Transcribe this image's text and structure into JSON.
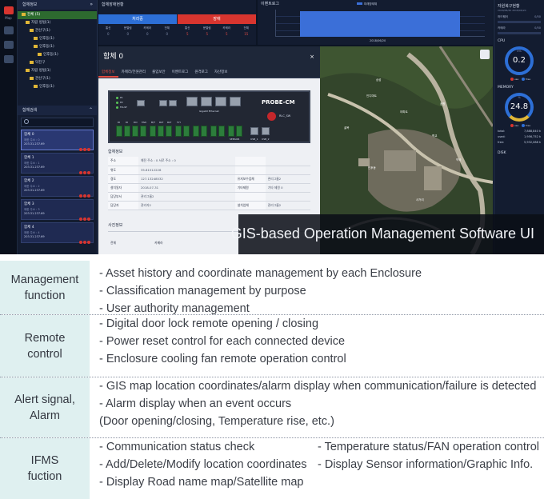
{
  "side_nav": {
    "items": [
      "Map",
      "",
      ""
    ]
  },
  "tree_panel": {
    "title": "함체정보",
    "nodes": [
      {
        "label": "전체 (5)",
        "depth": 1,
        "selected": true
      },
      {
        "label": "자람 방범(1)",
        "depth": 2
      },
      {
        "label": "관산구(1)",
        "depth": 3
      },
      {
        "label": "인후동(1)",
        "depth": 4
      },
      {
        "label": "인후동(1)",
        "depth": 4
      },
      {
        "label": "인후동(1)",
        "depth": 5
      },
      {
        "label": "덕진구",
        "depth": 3
      },
      {
        "label": "자람 방범(1)",
        "depth": 2
      },
      {
        "label": "관산구(1)",
        "depth": 3
      },
      {
        "label": "인후동(1)",
        "depth": 4
      }
    ]
  },
  "enclosure_search": {
    "title": "함체검색",
    "cards": [
      {
        "name": "함체 0",
        "sub": "제한 주소 : 0",
        "ip": "203.31.237.69",
        "selected": true
      },
      {
        "name": "함체 1",
        "sub": "제한 주소 : 1",
        "ip": "203.31.237.69"
      },
      {
        "name": "함체 2",
        "sub": "제한 주소 : 2",
        "ip": "203.31.237.69"
      },
      {
        "name": "함체 3",
        "sub": "제한 주소 : 3",
        "ip": "203.31.237.69"
      },
      {
        "name": "함체 4",
        "sub": "제한 주소 : 4",
        "ip": "203.31.237.69"
      }
    ]
  },
  "status": {
    "title": "함체장애현황",
    "normal": {
      "label": "처리중",
      "color": "#2d6fd6",
      "cols": [
        "통신",
        "문열림",
        "카메라",
        "전체"
      ],
      "vals": [
        "0",
        "0",
        "0",
        "0"
      ]
    },
    "fault": {
      "label": "장애",
      "color": "#d8352f",
      "cols": [
        "통신",
        "문열림",
        "카메라",
        "전체"
      ],
      "vals": [
        "5",
        "5",
        "5",
        "15"
      ]
    }
  },
  "event_log": {
    "title": "이벤트로그",
    "legend": "미래방재체",
    "date": "2018/06/20",
    "series_color": "#3b6fd8"
  },
  "resources": {
    "title": "자원복구현황",
    "subtitle": "2018/06/20 2018/06/20",
    "rows": [
      {
        "label": "하드웨어",
        "value": "0/50"
      },
      {
        "label": "카메라",
        "value": "0/50"
      }
    ],
    "cpu": {
      "title": "CPU",
      "value": "0.2",
      "pct_label": "0%",
      "legend_use": "use",
      "legend_free": "free"
    },
    "memory": {
      "title": "MEMORY",
      "value": "24.8",
      "pct_label": "%",
      "legend_use": "use",
      "legend_free": "free",
      "stats": [
        {
          "k": "total:",
          "v": "7,888,840 k"
        },
        {
          "k": "used:",
          "v": "1,956,752 k"
        },
        {
          "k": "free:",
          "v": "5,932,088 k"
        }
      ]
    },
    "disk": {
      "title": "DISK"
    }
  },
  "modal": {
    "title": "함체 0",
    "close": "×",
    "tabs": [
      "함체정보",
      "카메라/전원관리",
      "출입보안",
      "이벤트로그",
      "원격로그",
      "자산정보"
    ],
    "active_tab": 0,
    "device": {
      "brand": "PROBE-CM",
      "button_label": "RLC_SW",
      "leds": [
        "P1",
        "P2",
        "FAULT"
      ],
      "bottom_labels": [
        "DI",
        "DI",
        "DO",
        "FAN",
        "B/T",
        "RLT",
        "RLT",
        "T.H",
        "SENSOR",
        "USB_1",
        "USB_2"
      ],
      "port_label": "Gigabit Ethernet"
    },
    "info": {
      "title": "함체정보",
      "rows": [
        {
          "k": "주소",
          "v": "예전 주소 : 0 서로 주소 : 0",
          "k2": "",
          "v2": ""
        },
        {
          "k": "위도",
          "v": "35.81512226",
          "k2": "",
          "v2": ""
        },
        {
          "k": "경도",
          "v": "127.13248532",
          "k2": "유지보수업체",
          "v2": "관리그룹2"
        },
        {
          "k": "설치일자",
          "v": "2018-07-31",
          "k2": "기타제원",
          "v2": "기타 제원 0"
        },
        {
          "k": "담당부서",
          "v": "관리그룹2",
          "k2": "",
          "v2": ""
        },
        {
          "k": "담당자",
          "v": "관리자2",
          "k2": "설치업체",
          "v2": "관리그룹2"
        }
      ]
    },
    "photo": {
      "title": "사진정보",
      "tabs": [
        "전체",
        "카메라"
      ]
    }
  },
  "map": {
    "labels": [
      "삼성",
      "인디마트",
      "아파트",
      "공원",
      "학교",
      "인후동",
      "사거리",
      "골목",
      "약국"
    ]
  },
  "caption": "GIS-based Operation Management Software UI",
  "features": [
    {
      "label": "Management\nfunction",
      "items": [
        "- Asset history and coordinate management by each Enclosure",
        "- Classification management by purpose",
        "- User authority management"
      ],
      "items_right": []
    },
    {
      "label": "Remote\ncontrol",
      "items": [
        "- Digital door lock remote opening / closing",
        "- Power reset control for each connected device",
        "- Enclosure cooling fan remote operation control"
      ],
      "items_right": []
    },
    {
      "label": "Alert signal,\nAlarm",
      "items": [
        "- GIS map location coordinates/alarm display when communication/failure is detected",
        "- Alarm display when an event occurs",
        "  (Door opening/closing, Temperature rise, etc.)"
      ],
      "items_right": []
    },
    {
      "label": "IFMS\nfuction",
      "items": [
        "- Communication status check",
        "- Add/Delete/Modify location coordinates",
        "- Display Road name map/Satellite map"
      ],
      "items_right": [
        "- Temperature status/FAN operation control",
        "- Display Sensor information/Graphic Info."
      ]
    }
  ]
}
